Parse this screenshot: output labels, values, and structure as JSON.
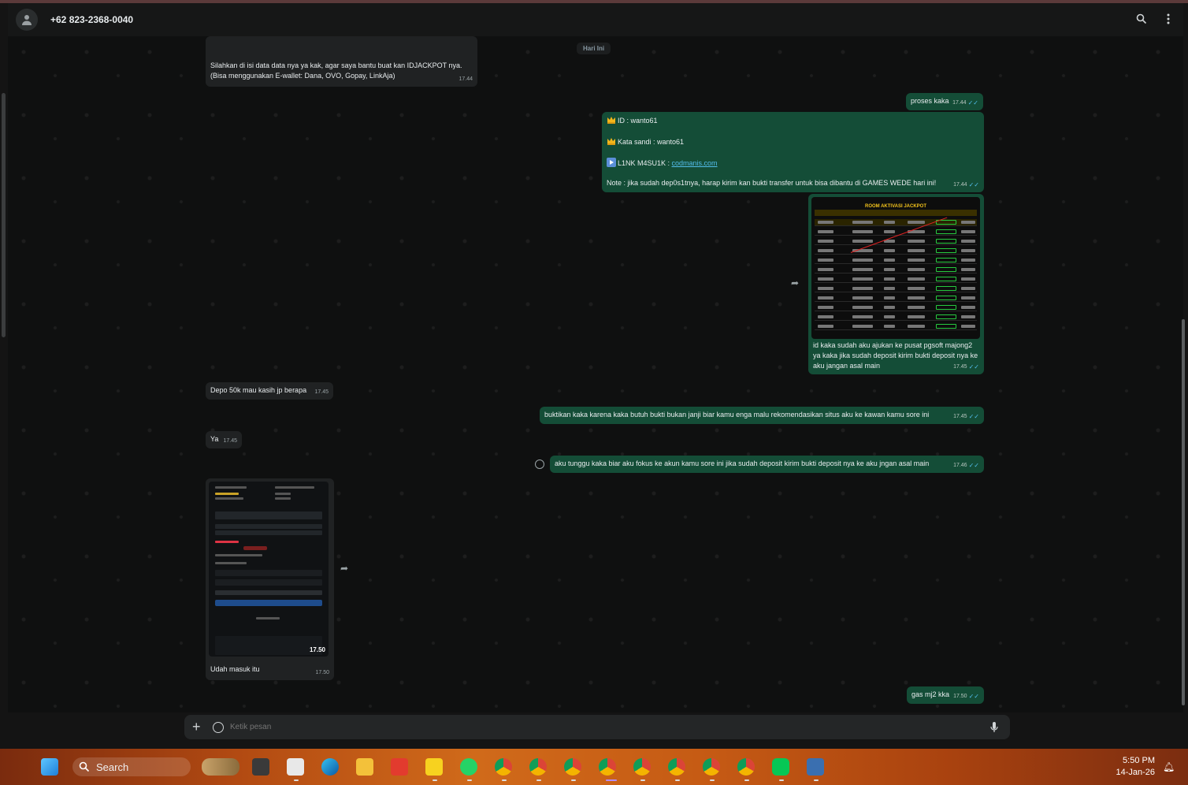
{
  "header": {
    "contact_name": "+62 823-2368-0040"
  },
  "chat": {
    "date_separator": "Hari Ini",
    "messages": {
      "m1": {
        "text": "Silahkan di isi data data nya ya kak, agar saya bantu buat kan IDJACKPOT nya.\n(Bisa menggunakan E-wallet: Dana, OVO, Gopay, LinkAja)",
        "time": "17.44"
      },
      "m2": {
        "text": "proses kaka",
        "time": "17.44"
      },
      "m3": {
        "line1": "ID :  wanto61",
        "line2": "Kata sandi : wanto61",
        "line3_prefix": "L1NK M4SU1K : ",
        "line3_link": "codmanis.com",
        "line4": "Note : jika sudah dep0s1tnya, harap kirim kan bukti transfer untuk bisa dibantu di GAMES WEDE hari ini!",
        "time": "17.44"
      },
      "m4": {
        "image_title": "ROOM AKTIVASI JACKPOT",
        "caption": "id kaka sudah aku ajukan ke pusat pgsoft majong2 ya kaka jika sudah deposit kirim bukti deposit nya ke aku jangan asal main",
        "time": "17.45"
      },
      "m5": {
        "text": "Depo 50k mau kasih jp berapa",
        "time": "17.45"
      },
      "m6": {
        "text": "buktikan kaka karena kaka butuh bukti bukan janji biar kamu enga malu rekomendasikan situs aku ke kawan kamu sore ini",
        "time": "17.45"
      },
      "m7": {
        "text": "Ya",
        "time": "17.45"
      },
      "m8": {
        "text": "aku tunggu kaka biar aku fokus ke akun kamu sore ini jika sudah deposit kirim bukti deposit nya ke aku jngan asal main",
        "time": "17.46"
      },
      "m9": {
        "image_time": "17.50",
        "caption": "Udah masuk itu",
        "time": "17.50"
      },
      "m10": {
        "text": "gas mj2 kka",
        "time": "17.50"
      }
    }
  },
  "composer": {
    "placeholder": "Ketik pesan"
  },
  "taskbar": {
    "search_label": "Search",
    "time": "5:50 PM",
    "date": "14-Jan-26"
  },
  "colors": {
    "outgoing_bubble": "#144d37",
    "incoming_bubble": "#202223",
    "read_tick": "#53bdeb",
    "link": "#53bdeb"
  }
}
